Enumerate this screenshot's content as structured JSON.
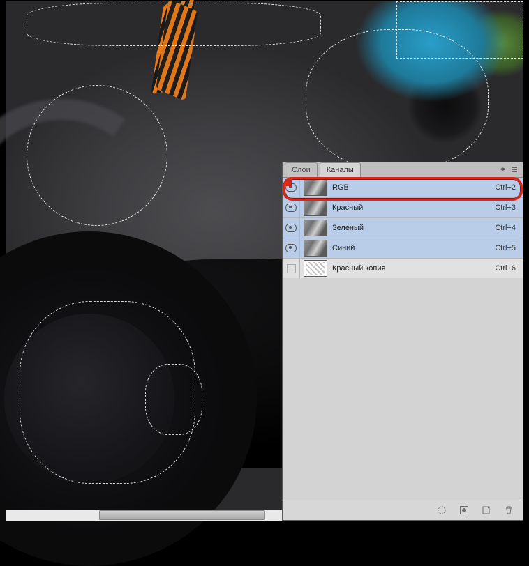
{
  "tabs": {
    "layers": "Слои",
    "channels": "Каналы"
  },
  "channels": [
    {
      "name": "RGB",
      "shortcut": "Ctrl+2",
      "visible": true,
      "selected": true
    },
    {
      "name": "Красный",
      "shortcut": "Ctrl+3",
      "visible": true,
      "selected": true
    },
    {
      "name": "Зеленый",
      "shortcut": "Ctrl+4",
      "visible": true,
      "selected": true
    },
    {
      "name": "Синий",
      "shortcut": "Ctrl+5",
      "visible": true,
      "selected": true
    },
    {
      "name": "Красный копия",
      "shortcut": "Ctrl+6",
      "visible": false,
      "selected": false
    }
  ],
  "footer_icons": [
    "load-selection",
    "save-selection",
    "new-channel",
    "delete-channel"
  ]
}
